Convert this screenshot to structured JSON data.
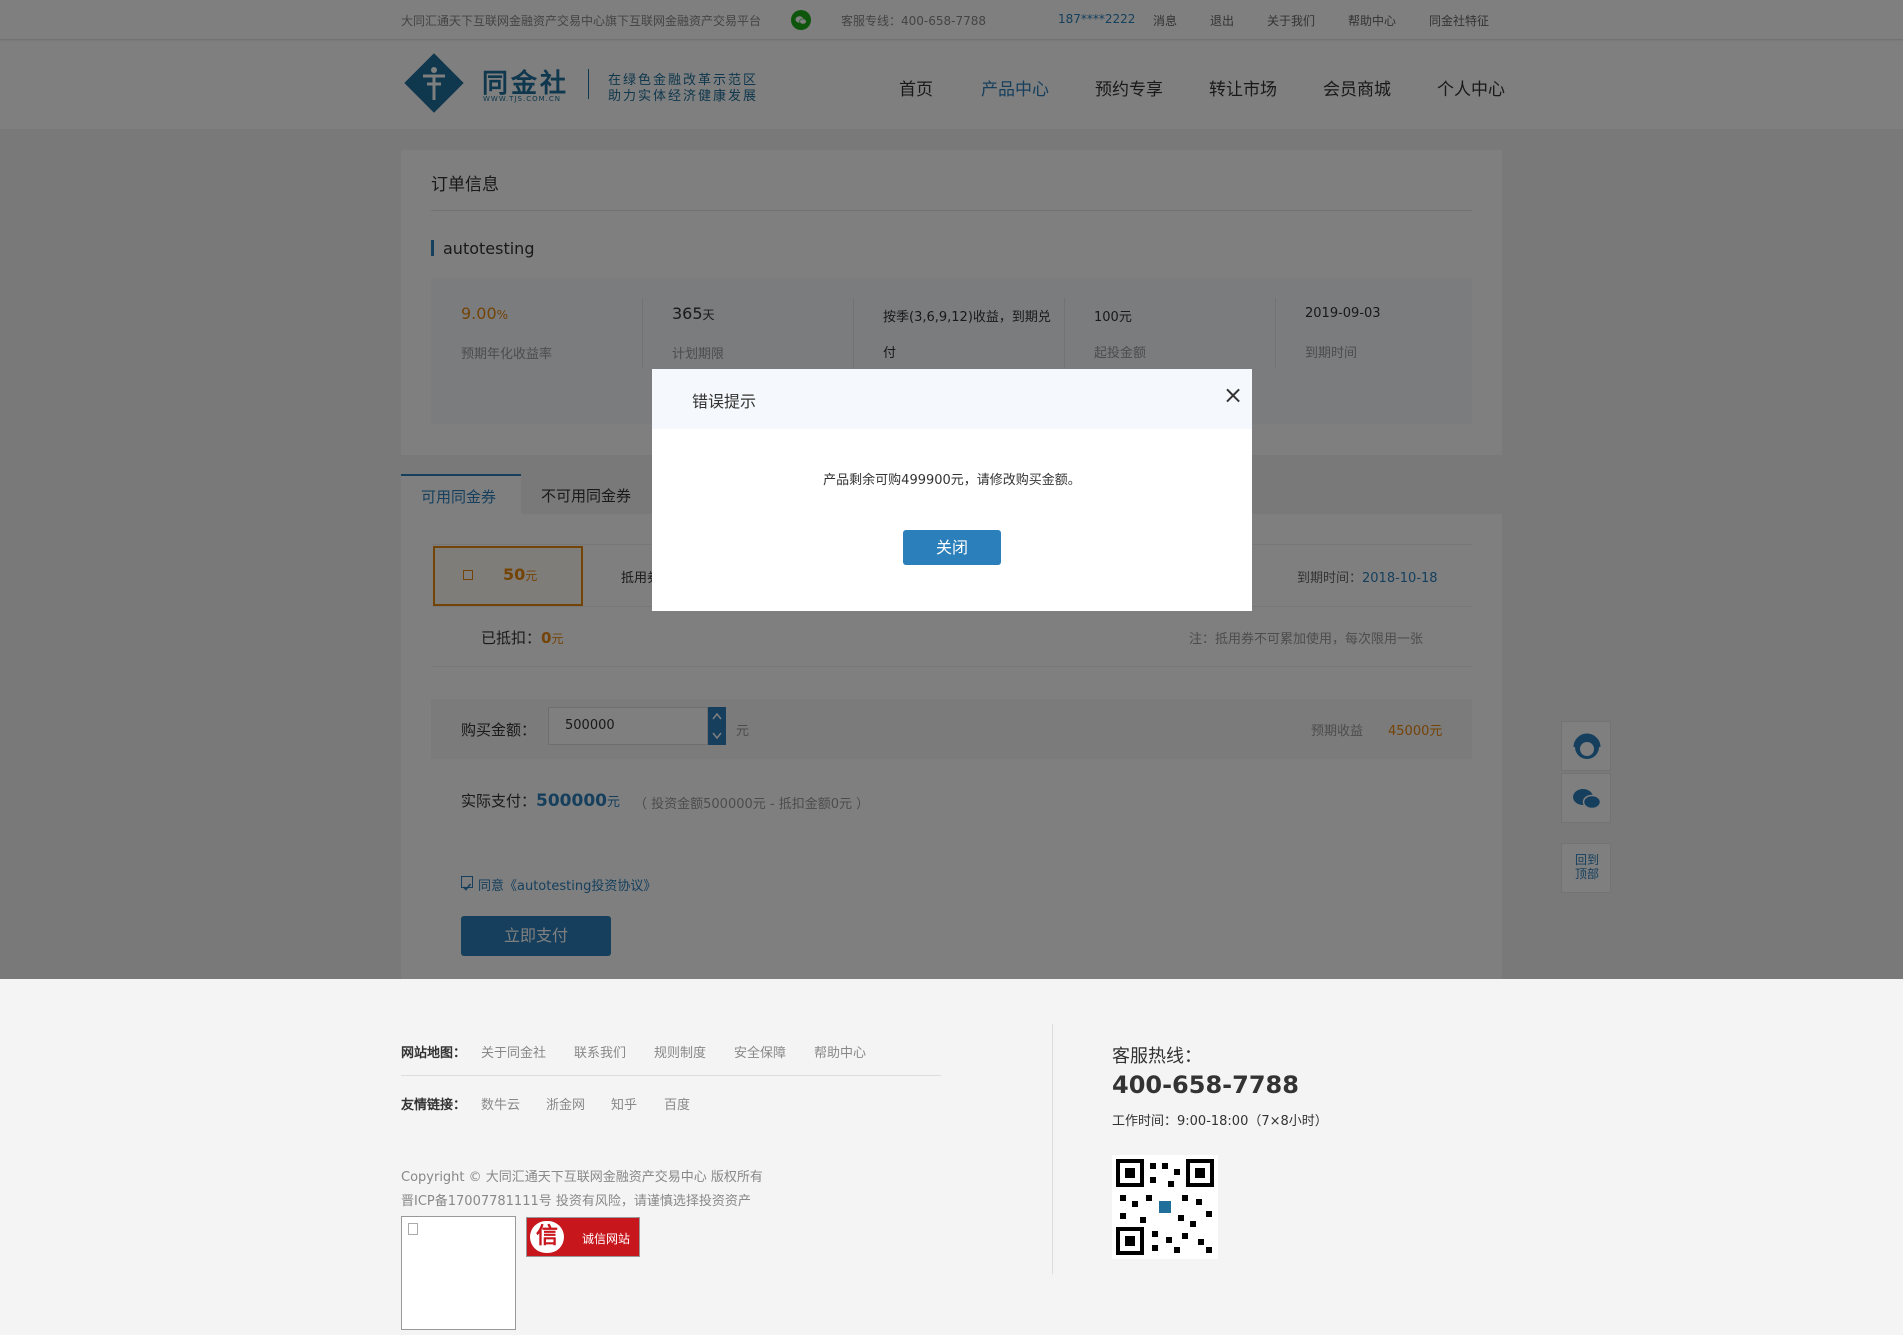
{
  "topbar": {
    "slogan": "大同汇通天下互联网金融资产交易中心旗下互联网金融资产交易平台",
    "hotline": "客服专线：400-658-7788",
    "user": "187****2222",
    "links": [
      "消息",
      "退出",
      "关于我们",
      "帮助中心",
      "同金社特征"
    ]
  },
  "header": {
    "logo_text": "同金社",
    "logo_url": "WWW.TJS.COM.CN",
    "tagline1": "在绿色金融改革示范区",
    "tagline2": "助力实体经济健康发展",
    "nav": [
      "首页",
      "产品中心",
      "预约专享",
      "转让市场",
      "会员商城",
      "个人中心"
    ]
  },
  "order": {
    "title": "订单信息",
    "product_name": "autotesting",
    "rate": "9.00",
    "rate_unit": "%",
    "rate_label": "预期年化收益率",
    "term": "365",
    "term_unit": "天",
    "term_label": "计划期限",
    "repay": "按季(3,6,9,12)收益，到期兑",
    "repay2": "付",
    "min_invest": "100元",
    "min_label": "起投金额",
    "due_date": "2019-09-03",
    "due_label": "到期时间"
  },
  "coupons": {
    "tab_available": "可用同金券",
    "tab_unavailable": "不可用同金券",
    "coupon_amount": "50",
    "coupon_unit": "元",
    "coupon_use": "抵用券",
    "paren": "）",
    "expire_label": "到期时间：",
    "expire_date": "2018-10-18",
    "deducted_label": "已抵扣：",
    "deducted_value": "0",
    "deducted_unit": "元",
    "note": "注：抵用券不可累加使用，每次限用一张"
  },
  "purchase": {
    "amount_label": "购买金额：",
    "amount_value": "500000",
    "amount_unit": "元",
    "expected_label": "预期收益",
    "expected_value": "45000元",
    "pay_label": "实际支付：",
    "pay_value": "500000",
    "pay_unit": "元",
    "pay_detail": "（ 投资金额500000元 - 抵扣金额0元 ）",
    "agree_text": "同意《autotesting投资协议》",
    "pay_button": "立即支付"
  },
  "sidebar": {
    "backtop": "回到顶部"
  },
  "modal": {
    "title": "错误提示",
    "close_icon": "×",
    "message": "产品剩余可购499900元，请修改购买金额。",
    "close_button": "关闭"
  },
  "footer": {
    "sitemap_label": "网站地图：",
    "sitemap": [
      "关于同金社",
      "联系我们",
      "规则制度",
      "安全保障",
      "帮助中心"
    ],
    "friend_label": "友情链接：",
    "friends": [
      "数牛云",
      "浙金网",
      "知乎",
      "百度"
    ],
    "copyright": "Copyright © 大同汇通天下互联网金融资产交易中心 版权所有",
    "icp": "晋ICP备17007781111号 投资有风险，请谨慎选择投资资产",
    "badge": "诚信网站",
    "badge_glyph": "信",
    "hotline_label": "客服热线：",
    "hotline": "400-658-7788",
    "hours": "工作时间：9:00-18:00（7×8小时）"
  },
  "colors": {
    "brand": "#2b7fba",
    "accent": "#e8860c"
  }
}
